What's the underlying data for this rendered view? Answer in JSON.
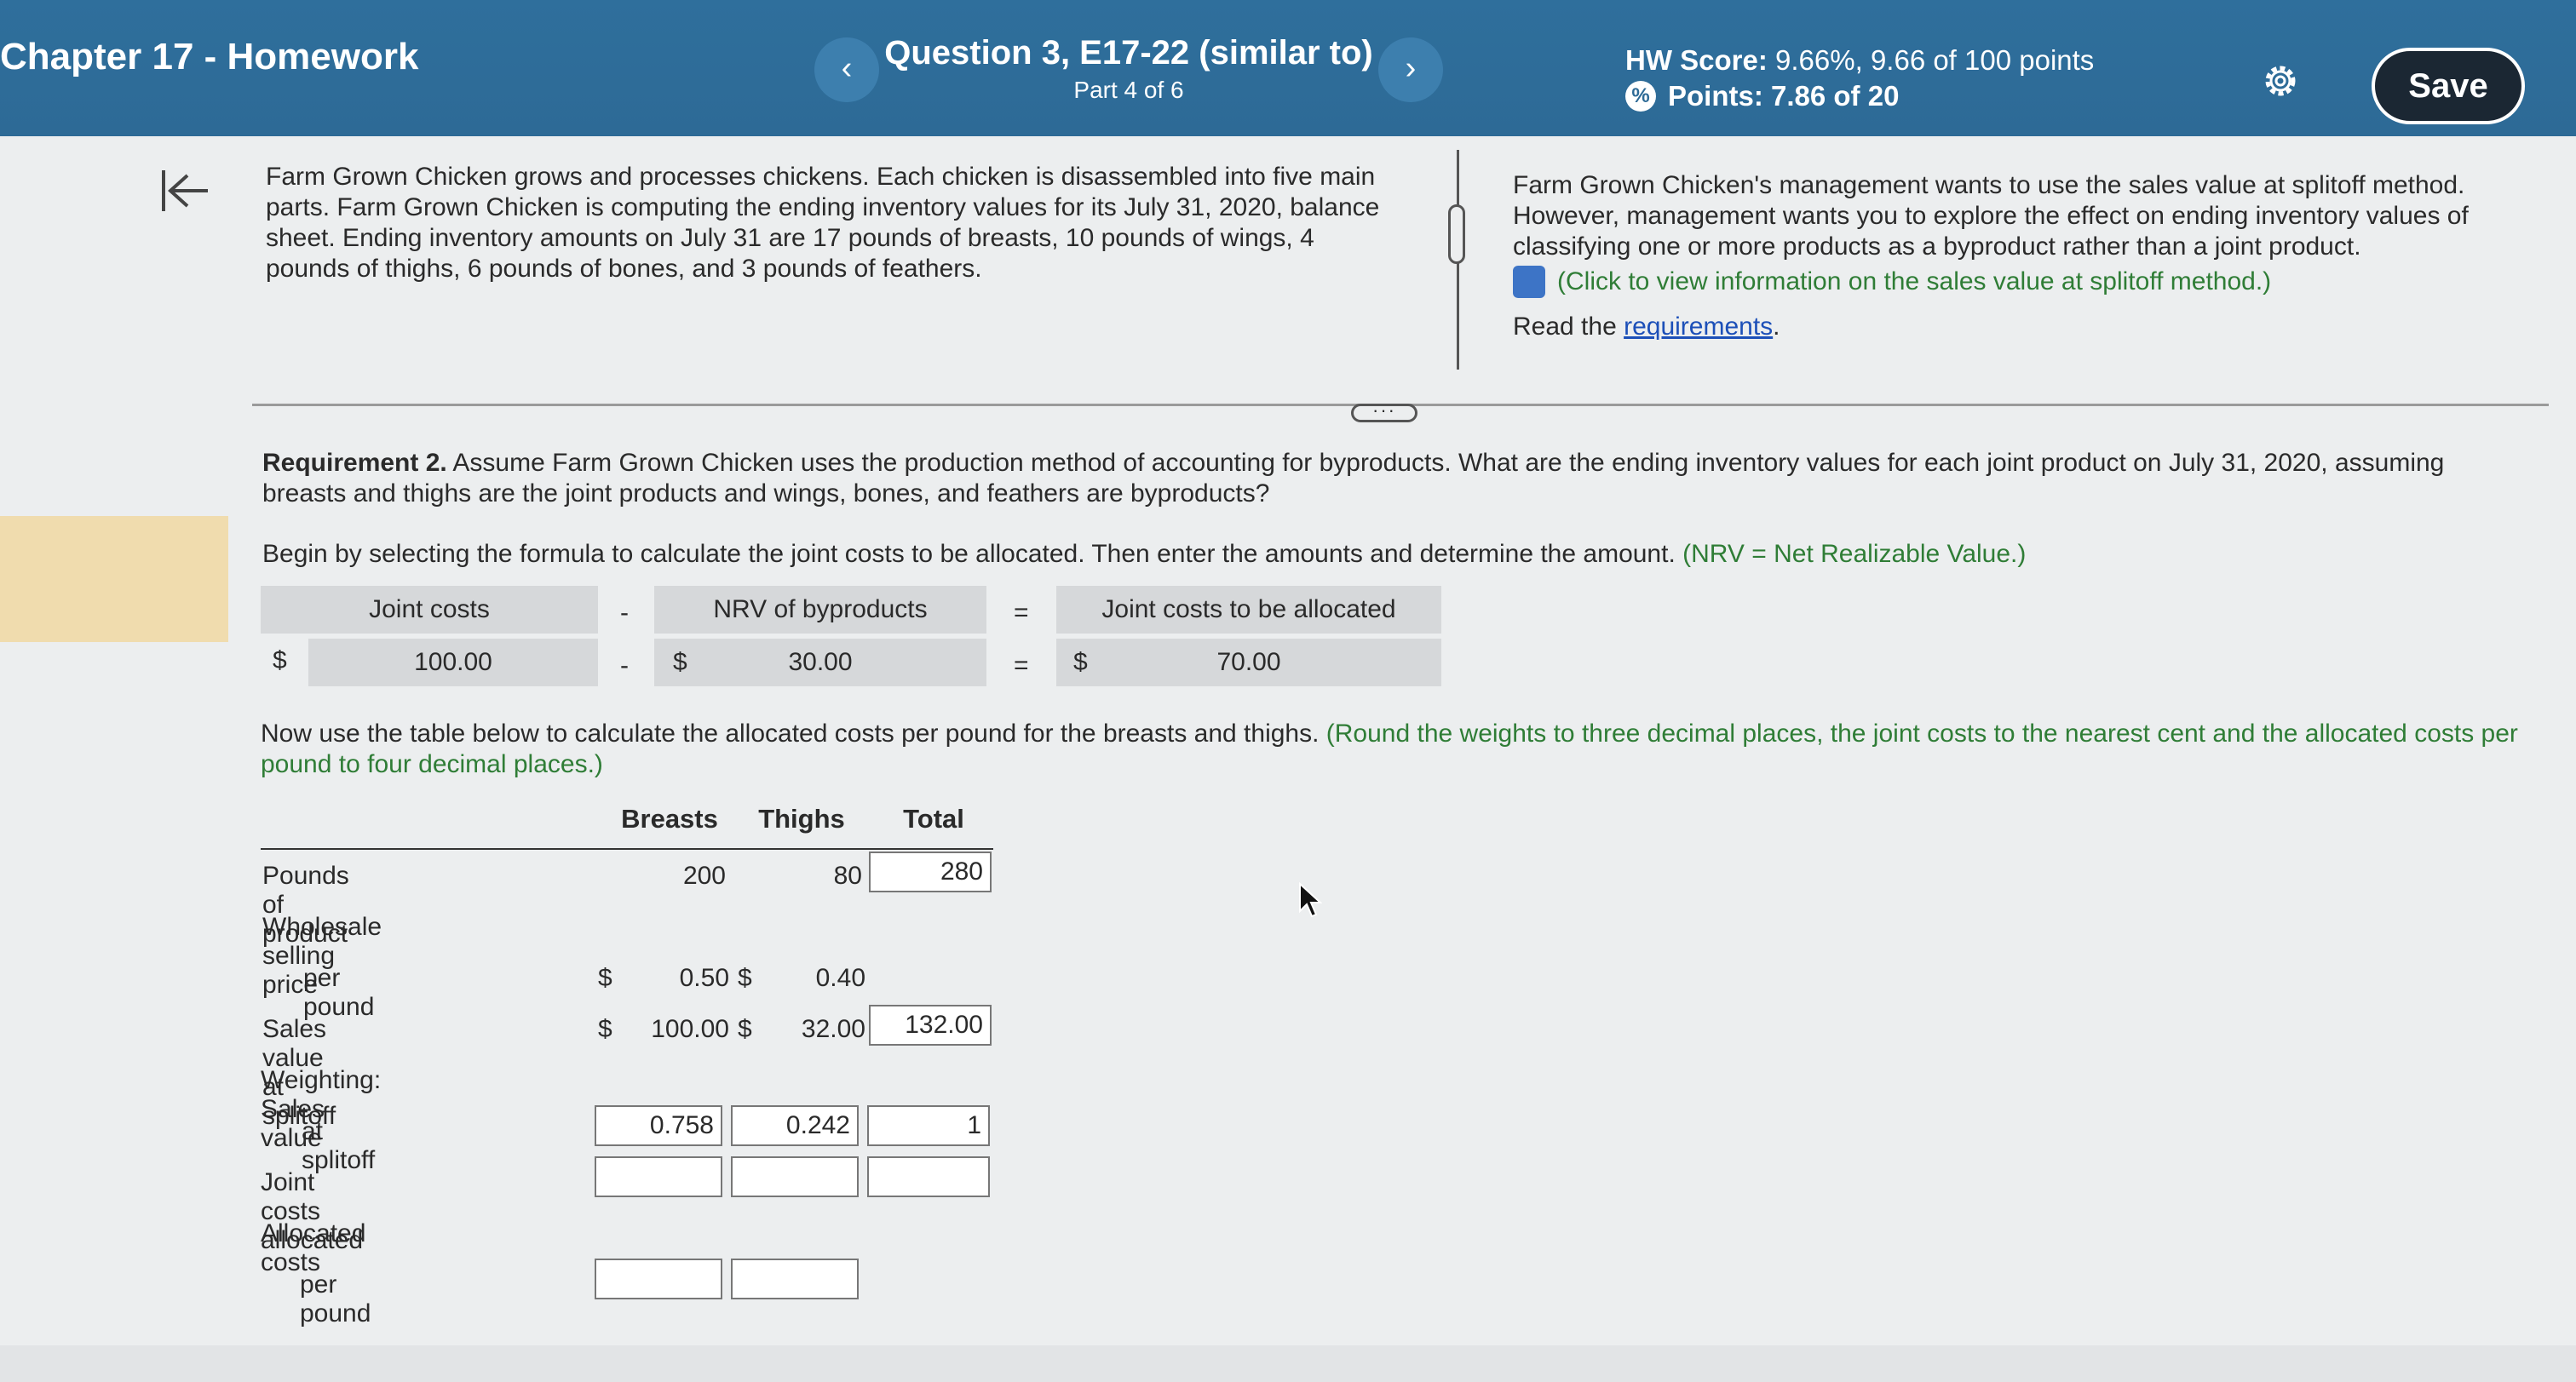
{
  "header": {
    "chapter_title": "Chapter 17 - Homework",
    "question_title": "Question 3, E17-22 (similar to)",
    "part": "Part 4 of 6",
    "hw_score_label": "HW Score:",
    "hw_score_value": "9.66%, 9.66 of 100 points",
    "points_label": "Points:",
    "points_value": "7.86 of 20",
    "prev_icon": "chevron-left-icon",
    "next_icon": "chevron-right-icon",
    "save_label": "Save"
  },
  "problem": {
    "left_text": "Farm Grown Chicken grows and processes chickens. Each chicken is disassembled into five main parts. Farm Grown Chicken is computing the ending inventory values for its July 31, 2020, balance sheet. Ending inventory amounts on July 31 are 17 pounds of breasts, 10 pounds of wings, 4 pounds of thighs, 6 pounds of bones, and 3 pounds of feathers.",
    "right_text": "Farm Grown Chicken's management wants to use the sales value at splitoff method. However, management wants you to explore the effect on ending inventory values of classifying one or more products as a byproduct rather than a joint product.",
    "info_link": "(Click to view information on the sales value at splitoff method.)",
    "read_prefix": "Read the ",
    "read_link": "requirements",
    "read_suffix": "."
  },
  "requirement": {
    "label": "Requirement 2.",
    "text": " Assume Farm Grown Chicken uses the production method of accounting for byproducts. What are the ending inventory values for each joint product on July 31, 2020, assuming breasts and thighs are the joint products and wings, bones, and feathers are byproducts?",
    "begin_text": "Begin by selecting the formula to calculate the joint costs to be allocated. Then enter the amounts and determine the amount.",
    "begin_hint": " (NRV = Net Realizable Value.)"
  },
  "formula": {
    "col1_header": "Joint costs",
    "col2_header": "NRV of byproducts",
    "col3_header": "Joint costs to be allocated",
    "minus": "-",
    "equals": "=",
    "dollar": "$",
    "joint_costs": "100.00",
    "nrv_byproducts": "30.00",
    "joint_costs_allocated": "70.00"
  },
  "table_intro": {
    "text": "Now use the table below to calculate the allocated costs per pound for the breasts and thighs.",
    "hint": " (Round the weights to three decimal places, the joint costs to the nearest cent and the allocated costs per pound to four decimal places.)"
  },
  "table": {
    "headers": [
      "Breasts",
      "Thighs",
      "Total"
    ],
    "rows": {
      "pounds_label": "Pounds of product",
      "pounds_breasts": "200",
      "pounds_thighs": "80",
      "pounds_total": "280",
      "wsp_label_1": "Wholesale selling price",
      "wsp_label_2": "per pound",
      "wsp_breasts": "0.50",
      "wsp_thighs": "0.40",
      "sales_label": "Sales value at splitoff",
      "sales_breasts": "100.00",
      "sales_thighs": "32.00",
      "sales_total": "132.00",
      "weight_label_1": "Weighting: Sales value",
      "weight_label_2": "at splitoff",
      "weight_breasts": "0.758",
      "weight_thighs": "0.242",
      "weight_total": "1",
      "jca_label": "Joint costs allocated",
      "jca_breasts": "",
      "jca_thighs": "",
      "jca_total": "",
      "acpp_label_1": "Allocated costs",
      "acpp_label_2": "per pound",
      "acpp_breasts": "",
      "acpp_thighs": ""
    },
    "dollar": "$"
  },
  "colors": {
    "header_bg": "#2d6a96",
    "hint_green": "#2f7d36",
    "link_blue": "#1c4fb8",
    "save_bg": "#1b2733"
  }
}
